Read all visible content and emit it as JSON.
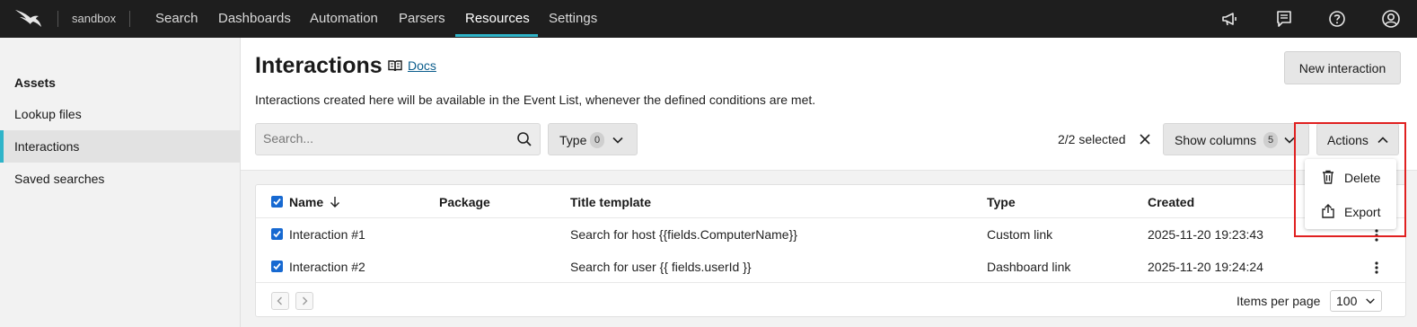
{
  "topbar": {
    "repo": "sandbox",
    "nav": [
      "Search",
      "Dashboards",
      "Automation",
      "Parsers",
      "Resources",
      "Settings"
    ],
    "active_nav": "Resources",
    "icons": [
      "megaphone-icon",
      "message-icon",
      "help-icon",
      "user-icon"
    ]
  },
  "sidebar": {
    "heading": "Assets",
    "items": [
      {
        "label": "Lookup files"
      },
      {
        "label": "Interactions",
        "active": true
      },
      {
        "label": "Saved searches"
      }
    ]
  },
  "header": {
    "title": "Interactions",
    "docs": "Docs",
    "new_button": "New interaction",
    "subtitle": "Interactions created here will be available in the Event List, whenever the defined conditions are met."
  },
  "toolbar": {
    "search_placeholder": "Search...",
    "type_label": "Type",
    "type_count": "0",
    "selected_text": "2/2 selected",
    "show_columns_label": "Show columns",
    "show_columns_count": "5",
    "actions_label": "Actions"
  },
  "actions_menu": {
    "items": [
      {
        "label": "Delete",
        "icon": "trash-icon"
      },
      {
        "label": "Export",
        "icon": "export-icon"
      }
    ]
  },
  "table": {
    "columns": [
      "Name",
      "Package",
      "Title template",
      "Type",
      "Created"
    ],
    "rows": [
      {
        "name": "Interaction #1",
        "package": "",
        "title_template": "Search for host {{fields.ComputerName}}",
        "type": "Custom link",
        "created": "2025-11-20 19:23:43",
        "checked": true
      },
      {
        "name": "Interaction #2",
        "package": "",
        "title_template": "Search for user {{ fields.userId }}",
        "type": "Dashboard link",
        "created": "2025-11-20 19:24:24",
        "checked": true
      }
    ],
    "items_per_page_label": "Items per page",
    "items_per_page": "100"
  },
  "colors": {
    "topbar": "#1e1e1e",
    "accent": "#2fb4c9",
    "checkbox": "#1769d1",
    "highlight": "#e02020"
  }
}
